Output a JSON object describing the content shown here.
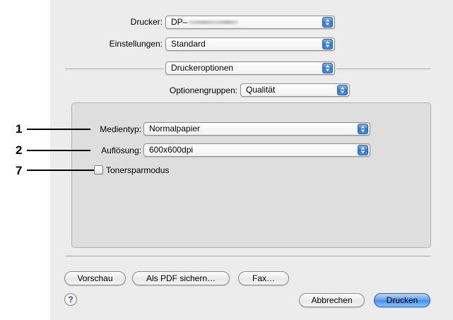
{
  "dialog": {
    "printer_label": "Drucker:",
    "printer_value": "DP–",
    "settings_label": "Einstellungen:",
    "settings_value": "Standard",
    "pane_value": "Druckeroptionen",
    "option_groups_label": "Optionengruppen:",
    "option_groups_value": "Qualität",
    "media_type_label": "Medientyp:",
    "media_type_value": "Normalpapier",
    "resolution_label": "Auflösung:",
    "resolution_value": "600x600dpi",
    "toner_save_label": "Tonersparmodus",
    "toner_save_checked": false
  },
  "buttons": {
    "preview": "Vorschau",
    "save_pdf": "Als PDF sichern…",
    "fax": "Fax…",
    "help": "?",
    "cancel": "Abbrechen",
    "print": "Drucken"
  },
  "callouts": [
    "1",
    "2",
    "7"
  ],
  "colors": {
    "dialog_bg": "#ececec",
    "groupbox_bg": "#dedede",
    "accent_blue": "#3f8cf0",
    "help_purple": "#6d2aa6"
  },
  "icons": {
    "popup_arrows": "up-down-arrows-icon",
    "help": "question-mark-icon"
  }
}
